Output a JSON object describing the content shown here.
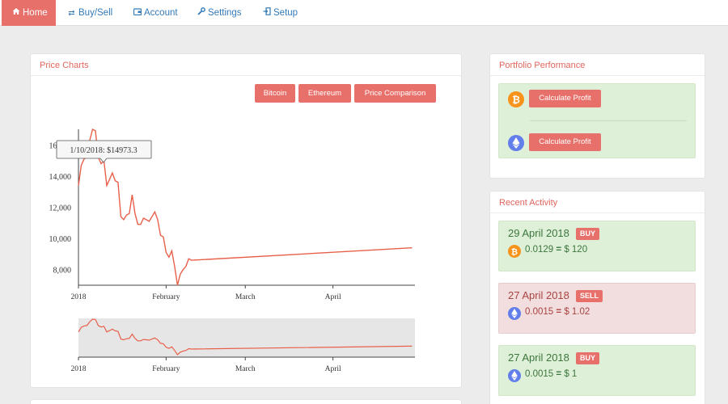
{
  "nav": {
    "items": [
      {
        "label": "Home",
        "icon": "home-icon",
        "active": true
      },
      {
        "label": "Buy/Sell",
        "icon": "swap-icon"
      },
      {
        "label": "Account",
        "icon": "wallet-icon"
      },
      {
        "label": "Settings",
        "icon": "wrench-icon"
      },
      {
        "label": "Setup",
        "icon": "sign-in-icon"
      }
    ]
  },
  "price_charts": {
    "title": "Price Charts",
    "buttons": [
      "Bitcoin",
      "Ethereum",
      "Price Comparison"
    ],
    "tooltip": "1/10/2018: $14973.3"
  },
  "portfolio": {
    "title": "Portfolio Performance",
    "buttons": [
      "Calculate Profit",
      "Calculate Profit"
    ]
  },
  "recent_activity": {
    "title": "Recent Activity",
    "items": [
      {
        "date": "29 April 2018",
        "type": "BUY",
        "coin": "bitcoin",
        "amount": "0.0129",
        "equals": "=",
        "value": "$ 120"
      },
      {
        "date": "27 April 2018",
        "type": "SELL",
        "coin": "ethereum",
        "amount": "0.0015",
        "equals": "=",
        "value": "$ 1.02"
      },
      {
        "date": "27 April 2018",
        "type": "BUY",
        "coin": "ethereum",
        "amount": "0.0015",
        "equals": "=",
        "value": "$ 1"
      }
    ]
  },
  "colors": {
    "accent": "#e8706a",
    "line": "#e8604a",
    "buy_bg": "#dff0d8",
    "sell_bg": "#f2dede",
    "link": "#337ab7"
  },
  "chart_data": {
    "type": "line",
    "x_tick_labels": [
      "2018",
      "February",
      "March",
      "April"
    ],
    "y_tick_labels": [
      "8,000",
      "10,000",
      "12,000",
      "14,000",
      "16,000"
    ],
    "ylim": [
      7000,
      17000
    ],
    "series": [
      {
        "x": [
          "2018-01-01",
          "2018-01-02",
          "2018-01-03",
          "2018-01-04",
          "2018-01-05",
          "2018-01-06",
          "2018-01-07",
          "2018-01-08",
          "2018-01-09",
          "2018-01-10",
          "2018-01-11",
          "2018-01-12",
          "2018-01-13",
          "2018-01-14",
          "2018-01-15",
          "2018-01-16",
          "2018-01-17",
          "2018-01-18",
          "2018-01-19",
          "2018-01-20",
          "2018-01-21",
          "2018-01-22",
          "2018-01-23",
          "2018-01-24",
          "2018-01-25",
          "2018-01-26",
          "2018-01-27",
          "2018-01-28",
          "2018-01-29",
          "2018-01-30",
          "2018-01-31",
          "2018-02-01",
          "2018-02-02",
          "2018-02-03",
          "2018-02-04",
          "2018-02-05",
          "2018-02-06",
          "2018-02-07",
          "2018-02-08",
          "2018-02-09",
          "2018-02-10",
          "2018-04-29"
        ],
        "y": [
          13400,
          14700,
          15100,
          15200,
          16300,
          17000,
          16900,
          15200,
          14800,
          14973,
          13400,
          13800,
          14200,
          13700,
          13600,
          11400,
          11200,
          11500,
          11600,
          12800,
          11600,
          10900,
          10900,
          11300,
          11200,
          11100,
          11400,
          11700,
          11200,
          10200,
          10100,
          9100,
          8800,
          9200,
          8200,
          7000,
          7700,
          8000,
          8200,
          8700,
          8600,
          9400
        ]
      }
    ],
    "navigator": {
      "x_tick_labels": [
        "2018",
        "February",
        "March",
        "April"
      ]
    }
  }
}
